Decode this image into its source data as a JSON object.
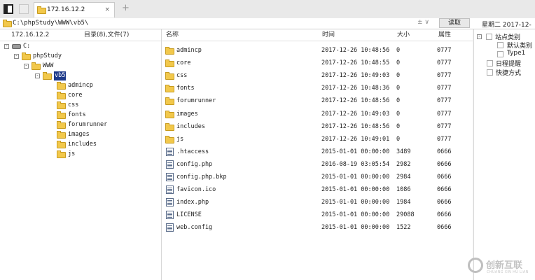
{
  "tab": {
    "title": "172.16.12.2",
    "close": "×",
    "add": "+"
  },
  "pathbar": {
    "path": "C:\\phpStudy\\WWW\\vb5\\",
    "dropdown": "± ∨",
    "read_label": "读取",
    "date": "星期二 2017-12-"
  },
  "left": {
    "host": "172.16.12.2",
    "summary": "目录(8),文件(7)",
    "tree": [
      {
        "label": "C:",
        "icon": "drive-icon",
        "expander": "⊟"
      },
      {
        "label": "phpStudy",
        "icon": "folder-icon",
        "expander": "⊟"
      },
      {
        "label": "WWW",
        "icon": "folder-icon",
        "expander": "⊟"
      },
      {
        "label": "vb5",
        "icon": "folder-icon",
        "expander": "⊟",
        "selected": true
      },
      {
        "label": "admincp",
        "icon": "folder-icon"
      },
      {
        "label": "core",
        "icon": "folder-icon"
      },
      {
        "label": "css",
        "icon": "folder-icon"
      },
      {
        "label": "fonts",
        "icon": "folder-icon"
      },
      {
        "label": "forumrunner",
        "icon": "folder-icon"
      },
      {
        "label": "images",
        "icon": "folder-icon"
      },
      {
        "label": "includes",
        "icon": "folder-icon"
      },
      {
        "label": "js",
        "icon": "folder-icon"
      }
    ]
  },
  "main": {
    "columns": {
      "name": "名称",
      "time": "时间",
      "size": "大小",
      "perm": "属性"
    },
    "files": [
      {
        "name": "admincp",
        "time": "2017-12-26 10:48:56",
        "size": "0",
        "perm": "0777",
        "type": "folder"
      },
      {
        "name": "core",
        "time": "2017-12-26 10:48:55",
        "size": "0",
        "perm": "0777",
        "type": "folder"
      },
      {
        "name": "css",
        "time": "2017-12-26 10:49:03",
        "size": "0",
        "perm": "0777",
        "type": "folder"
      },
      {
        "name": "fonts",
        "time": "2017-12-26 10:48:36",
        "size": "0",
        "perm": "0777",
        "type": "folder"
      },
      {
        "name": "forumrunner",
        "time": "2017-12-26 10:48:56",
        "size": "0",
        "perm": "0777",
        "type": "folder"
      },
      {
        "name": "images",
        "time": "2017-12-26 10:49:03",
        "size": "0",
        "perm": "0777",
        "type": "folder"
      },
      {
        "name": "includes",
        "time": "2017-12-26 10:48:56",
        "size": "0",
        "perm": "0777",
        "type": "folder"
      },
      {
        "name": "js",
        "time": "2017-12-26 10:49:01",
        "size": "0",
        "perm": "0777",
        "type": "folder"
      },
      {
        "name": ".htaccess",
        "time": "2015-01-01 00:00:00",
        "size": "3489",
        "perm": "0666",
        "type": "file"
      },
      {
        "name": "config.php",
        "time": "2016-08-19 03:05:54",
        "size": "2982",
        "perm": "0666",
        "type": "file"
      },
      {
        "name": "config.php.bkp",
        "time": "2015-01-01 00:00:00",
        "size": "2984",
        "perm": "0666",
        "type": "file"
      },
      {
        "name": "favicon.ico",
        "time": "2015-01-01 00:00:00",
        "size": "1086",
        "perm": "0666",
        "type": "file"
      },
      {
        "name": "index.php",
        "time": "2015-01-01 00:00:00",
        "size": "1984",
        "perm": "0666",
        "type": "file"
      },
      {
        "name": "LICENSE",
        "time": "2015-01-01 00:00:00",
        "size": "29088",
        "perm": "0666",
        "type": "file"
      },
      {
        "name": "web.config",
        "time": "2015-01-01 00:00:00",
        "size": "1522",
        "perm": "0666",
        "type": "file"
      }
    ]
  },
  "right": {
    "items": [
      {
        "label": "站点类别",
        "kind": "group",
        "expander": "⊟"
      },
      {
        "label": "默认类别",
        "kind": "child"
      },
      {
        "label": "Type1",
        "kind": "child"
      },
      {
        "label": "日程提醒",
        "kind": "top"
      },
      {
        "label": "快捷方式",
        "kind": "top"
      }
    ]
  },
  "watermark": {
    "text": "创新互联",
    "sub": "CHUANG XIN HU LIAN"
  }
}
